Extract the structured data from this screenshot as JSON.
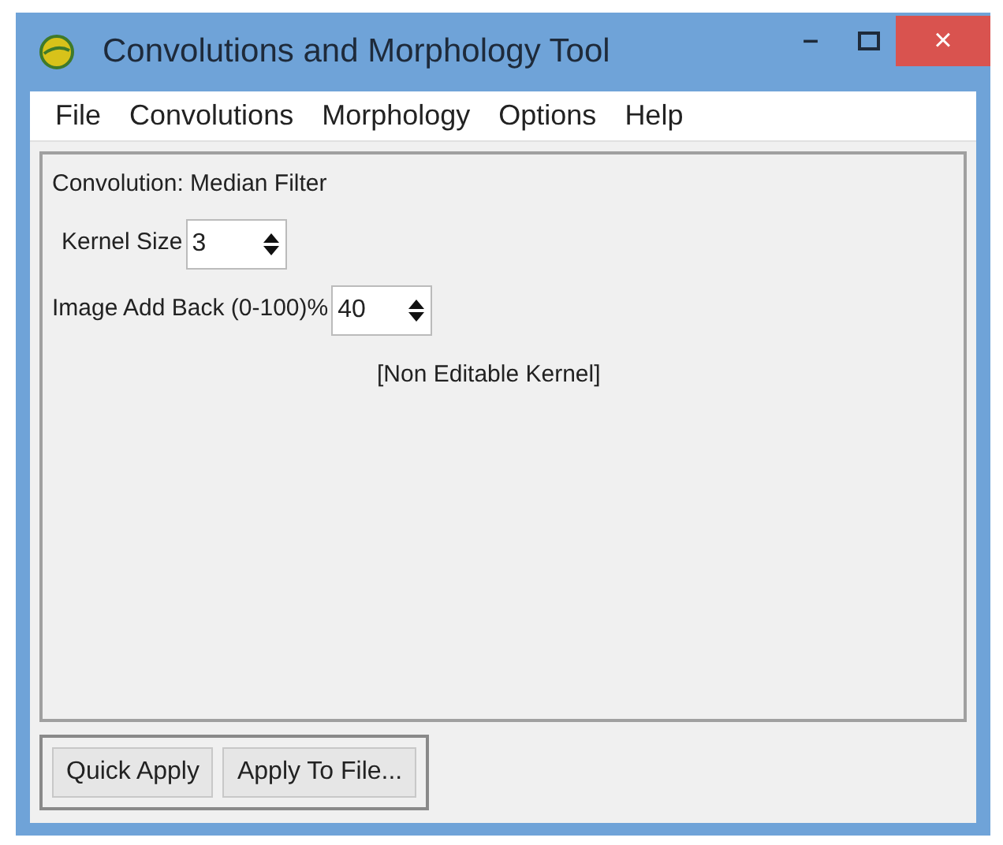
{
  "window": {
    "title": "Convolutions and Morphology Tool",
    "controls": [
      "–",
      "×"
    ]
  },
  "menu": [
    "File",
    "Convolutions",
    "Morphology",
    "Options",
    "Help"
  ],
  "panel": {
    "heading": "Convolution: Median Filter",
    "fields": [
      {
        "label": "Kernel Size",
        "value": "3"
      },
      {
        "label": "Image Add Back (0-100)%",
        "value": "40"
      }
    ],
    "note": "[Non Editable Kernel]"
  },
  "buttons": [
    "Quick Apply",
    "Apply To File..."
  ]
}
